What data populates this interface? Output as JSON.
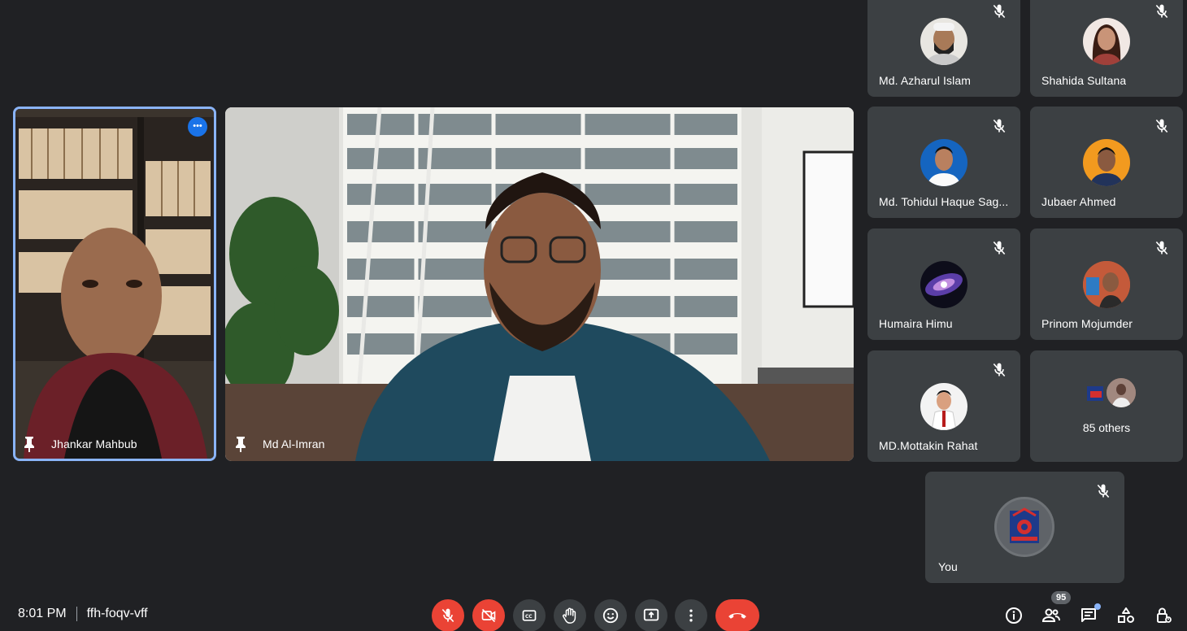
{
  "meeting": {
    "time": "8:01 PM",
    "code": "ffh-foqv-vff"
  },
  "main_tiles": [
    {
      "name": "Jhankar Mahbub",
      "more_label": "•••"
    },
    {
      "name": "Md Al-Imran"
    }
  ],
  "participants": [
    {
      "name": "Md. Azharul Islam"
    },
    {
      "name": "Shahida Sultana"
    },
    {
      "name": "Md. Tohidul Haque Sag..."
    },
    {
      "name": "Jubaer Ahmed"
    },
    {
      "name": "Humaira Himu"
    },
    {
      "name": "Prinom Mojumder"
    },
    {
      "name": "MD.Mottakin Rahat"
    }
  ],
  "others": {
    "label": "85 others"
  },
  "self": {
    "name": "You"
  },
  "people_count": "95",
  "colors": {
    "background": "#202124",
    "tile": "#3c4043",
    "red": "#ea4335",
    "accent": "#8ab4f8",
    "active_border": "#8ab4f8"
  }
}
